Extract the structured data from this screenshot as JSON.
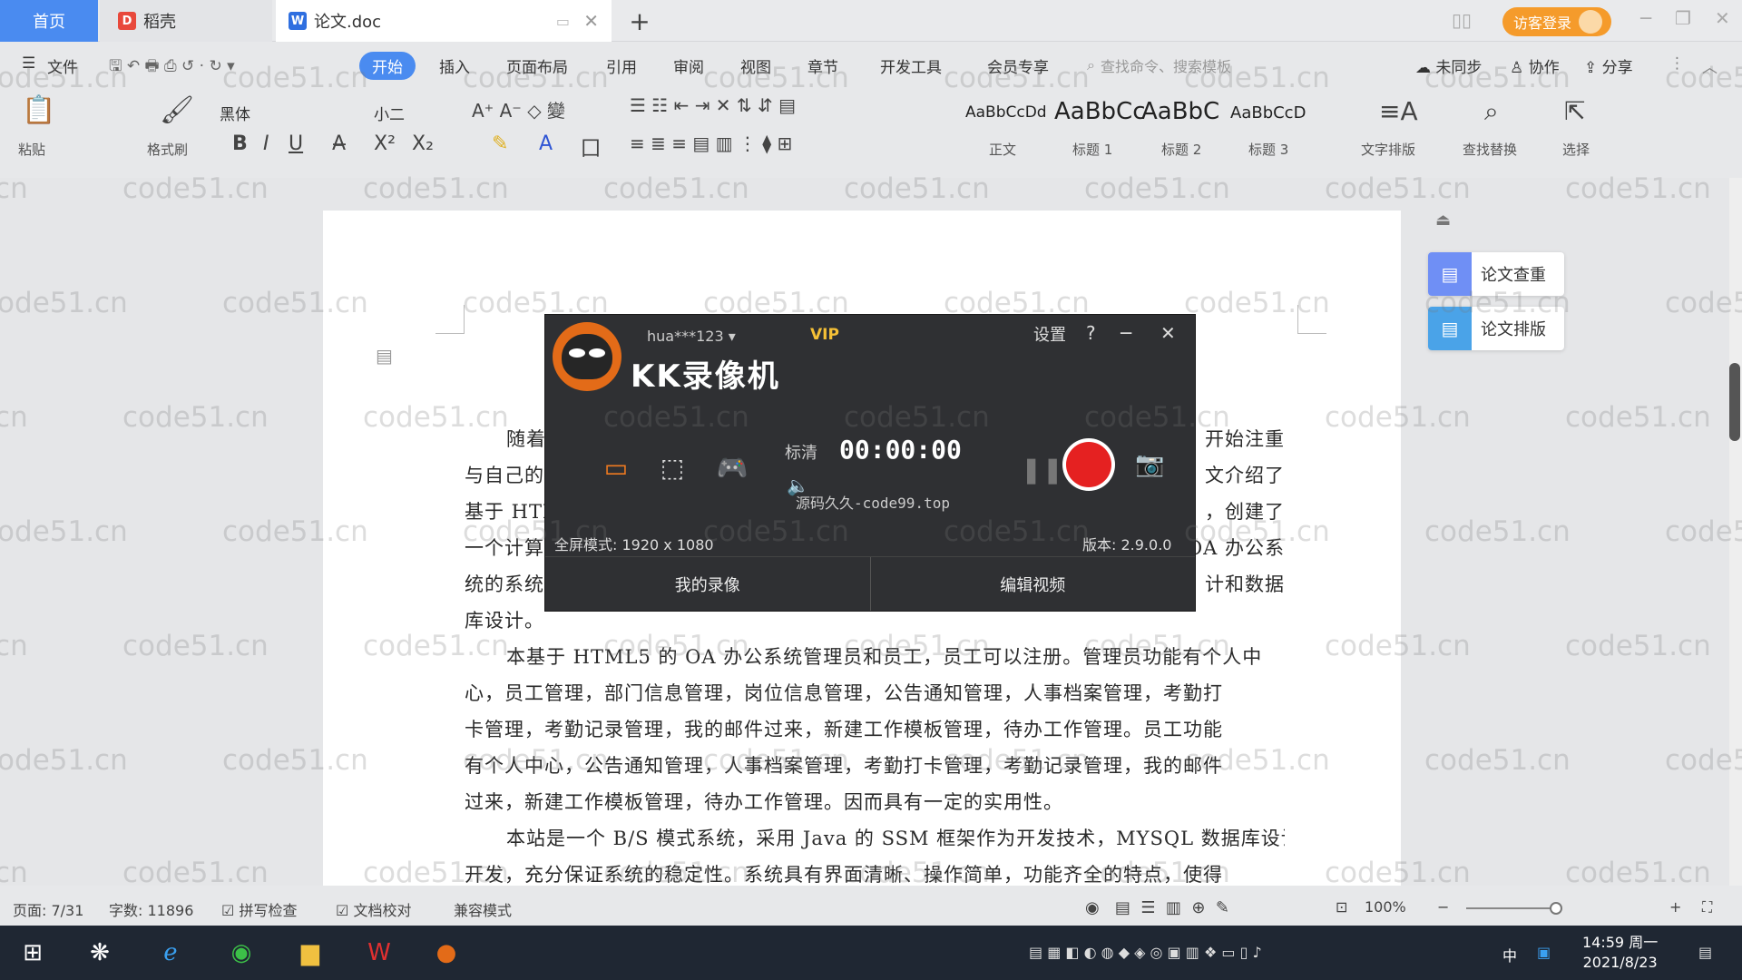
{
  "tabs": {
    "home": "首页",
    "daoke": "稻壳",
    "doc": "论文.doc",
    "new_tab": "+"
  },
  "titlebar": {
    "login": "访客登录"
  },
  "menu": {
    "file": "文件",
    "items": [
      "开始",
      "插入",
      "页面布局",
      "引用",
      "审阅",
      "视图",
      "章节",
      "开发工具",
      "会员专享"
    ],
    "search_placeholder": "查找命令、搜索模板",
    "unsynced": "未同步",
    "collab": "协作",
    "share": "分享"
  },
  "ribbon": {
    "paste": "粘贴",
    "format_painter": "格式刷",
    "font_name": "黑体",
    "font_size": "小二",
    "styles": [
      {
        "preview": "AaBbCcDd",
        "label": "正文"
      },
      {
        "preview": "AaBbCc",
        "label": "标题 1"
      },
      {
        "preview": "AaBbC",
        "label": "标题 2"
      },
      {
        "preview": "AaBbCcD",
        "label": "标题 3"
      }
    ],
    "text_tools": "文字排版",
    "find_replace": "查找替换",
    "select": "选择"
  },
  "document": {
    "lines": [
      {
        "left": "随着",
        "right": "开始注重"
      },
      {
        "left": "与自己的",
        "right": "文介绍了"
      },
      {
        "left": "基于 HTM",
        "right": "，创建了"
      },
      {
        "left": "一个计算",
        "right": "OA 办公系"
      },
      {
        "left": "统的系统",
        "right": "计和数据"
      }
    ],
    "line6": "库设计。",
    "p2_l1": "本基于 HTML5 的 OA 办公系统管理员和员工，员工可以注册。管理员功能有个人中",
    "p2_l2": "心，员工管理，部门信息管理，岗位信息管理，公告通知管理，人事档案管理，考勤打",
    "p2_l3": "卡管理，考勤记录管理，我的邮件过来，新建工作模板管理，待办工作管理。员工功能",
    "p2_l4": "有个人中心，公告通知管理，人事档案管理，考勤打卡管理，考勤记录管理，我的邮件",
    "p2_l5": "过来，新建工作模板管理，待办工作管理。因而具有一定的实用性。",
    "p3_l1": "本站是一个 B/S 模式系统，采用 Java 的 SSM 框架作为开发技术，MYSQL 数据库设计",
    "p3_l2": "开发，充分保证系统的稳定性。系统具有界面清晰、操作简单，功能齐全的特点，使得"
  },
  "side_panel": {
    "check": "论文查重",
    "layout": "论文排版"
  },
  "recorder": {
    "user": "hua***123",
    "vip": "VIP",
    "settings": "设置",
    "help": "?",
    "title": "KK录像机",
    "quality": "标清",
    "timer": "00:00:00",
    "watermark": "源码久久-code99.top",
    "fullscreen": "全屏模式: 1920 x 1080",
    "version": "版本: 2.9.0.0",
    "my_videos": "我的录像",
    "edit_video": "编辑视频"
  },
  "statusbar": {
    "page": "页面: 7/31",
    "words": "字数: 11896",
    "spellcheck": "拼写检查",
    "doc_check": "文档校对",
    "compat": "兼容模式",
    "zoom": "100%"
  },
  "taskbar": {
    "time": "14:59 周一",
    "date": "2021/8/23",
    "ime": "中"
  },
  "watermark_text": "code51.cn",
  "colors": {
    "accent": "#4a8bf0",
    "record": "#e52121",
    "login": "#f59b2b"
  }
}
